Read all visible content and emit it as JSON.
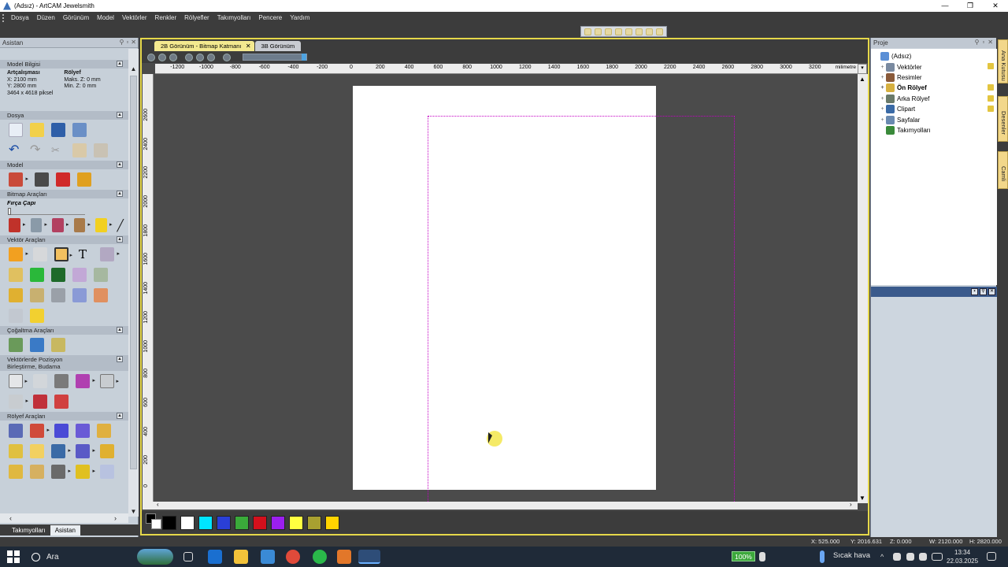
{
  "window": {
    "title": "(Adsız) - ArtCAM Jewelsmith",
    "controls": {
      "minimize": "—",
      "maximize": "❐",
      "close": "✕"
    }
  },
  "menu": [
    "Dosya",
    "Düzen",
    "Görünüm",
    "Model",
    "Vektörler",
    "Renkler",
    "Rölyefler",
    "Takımyolları",
    "Pencere",
    "Yardım"
  ],
  "left_panel": {
    "title": "Asistan",
    "model_info": {
      "header": "Model Bilgisi",
      "col1_title": "Artçalışması",
      "x": "X: 2100 mm",
      "y": "Y: 2800 mm",
      "pixels": "3464 x 4618 piksel",
      "col2_title": "Rölyef",
      "max_z": "Maks. Z: 0 mm",
      "min_z": "Min. Z: 0 mm"
    },
    "sections": {
      "dosya": "Dosya",
      "model": "Model",
      "bitmap": "Bitmap Araçları",
      "brush": "Fırça Çapı",
      "vector": "Vektör Araçları",
      "copy": "Çoğaltma Araçları",
      "position_l1": "Vektörlerde Pozisyon",
      "position_l2": "Birleştirme, Budama",
      "relief": "Rölyef Araçları"
    },
    "tabs": [
      "Takımyolları",
      "Asistan"
    ]
  },
  "doc": {
    "tabs": [
      "2B Görünüm - Bitmap Katmanı",
      "3B Görünüm"
    ],
    "ruler_unit": "milimetre",
    "ruler_x": [
      "-1200",
      "-1000",
      "-800",
      "-600",
      "-400",
      "-200",
      "0",
      "200",
      "400",
      "600",
      "800",
      "1000",
      "1200",
      "1400",
      "1600",
      "1800",
      "2000",
      "2200",
      "2400",
      "2600",
      "2800",
      "3000",
      "3200"
    ],
    "ruler_y": [
      "2600",
      "2400",
      "2200",
      "2000",
      "1800",
      "1600",
      "1400",
      "1200",
      "1000",
      "800",
      "600",
      "400",
      "200",
      "0"
    ]
  },
  "palette": [
    "#000000",
    "#ffffff",
    "#00e5ff",
    "#2a3fd6",
    "#3aaa3a",
    "#d4101c",
    "#9b1ff0",
    "#ffff40",
    "#a8a030",
    "#ffd400"
  ],
  "right_panel": {
    "title": "Proje",
    "tree": [
      {
        "label": "(Adsız)",
        "bold": false,
        "color": "#5a8fd6"
      },
      {
        "label": "Vektörler",
        "bold": false,
        "color": "#7a8aa0"
      },
      {
        "label": "Resimler",
        "bold": false,
        "color": "#8a5a3a"
      },
      {
        "label": "Ön Rölyef",
        "bold": true,
        "color": "#d6b040"
      },
      {
        "label": "Arka Rölyef",
        "bold": false,
        "color": "#6a7a6a"
      },
      {
        "label": "Clipart",
        "bold": false,
        "color": "#3a6aa6"
      },
      {
        "label": "Sayfalar",
        "bold": false,
        "color": "#6a8ab0"
      },
      {
        "label": "Takımyolları",
        "bold": false,
        "color": "#3a8a3a"
      }
    ]
  },
  "side_tabs": [
    "Ana Kutusu",
    "Desenler",
    "Camli"
  ],
  "status": {
    "x": "X: 525.000",
    "y": "Y: 2016.631",
    "z": "Z: 0.000",
    "w": "W: 2120.000",
    "h": "H: 2820.000"
  },
  "taskbar": {
    "search": "Ara",
    "zoom": "100%",
    "weather": "Sıcak hava",
    "time": "13:34",
    "date": "22.03.2025"
  }
}
